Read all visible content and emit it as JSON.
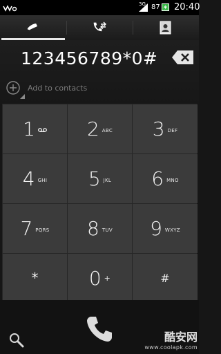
{
  "status_bar": {
    "network_type": "3G",
    "battery_percent": "87",
    "time": "20:40"
  },
  "tabs": [
    {
      "name": "tab-phone",
      "icon": "phone-icon",
      "selected": true
    },
    {
      "name": "tab-call-log",
      "icon": "call-log-icon",
      "selected": false
    },
    {
      "name": "tab-contacts",
      "icon": "contact-card-icon",
      "selected": false
    }
  ],
  "dialer": {
    "number": "123456789*0#",
    "add_to_contacts_label": "Add to contacts"
  },
  "keypad": {
    "keys": [
      {
        "digit": "1",
        "letters": "",
        "voicemail": true
      },
      {
        "digit": "2",
        "letters": "ABC"
      },
      {
        "digit": "3",
        "letters": "DEF"
      },
      {
        "digit": "4",
        "letters": "GHI"
      },
      {
        "digit": "5",
        "letters": "JKL"
      },
      {
        "digit": "6",
        "letters": "MNO"
      },
      {
        "digit": "7",
        "letters": "PQRS"
      },
      {
        "digit": "8",
        "letters": "TUV"
      },
      {
        "digit": "9",
        "letters": "WXYZ"
      },
      {
        "digit": "*",
        "letters": ""
      },
      {
        "digit": "0",
        "letters": "+"
      },
      {
        "digit": "#",
        "letters": ""
      }
    ]
  },
  "watermark": {
    "brand": "酷安网",
    "url": "www.coolapk.com"
  }
}
